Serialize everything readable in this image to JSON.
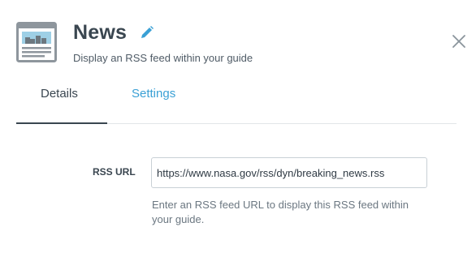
{
  "header": {
    "title": "News",
    "subtitle": "Display an RSS feed within your guide",
    "widget_icon": "news-widget-icon",
    "edit_icon": "pencil-icon",
    "close_icon": "close-icon"
  },
  "tabs": [
    {
      "label": "Details",
      "active": true
    },
    {
      "label": "Settings",
      "active": false
    }
  ],
  "form": {
    "rss_url_label": "RSS URL",
    "rss_url_value": "https://www.nasa.gov/rss/dyn/breaking_news.rss",
    "help_text": "Enter an RSS feed URL to display this RSS feed within your guide."
  },
  "colors": {
    "title": "#3a4650",
    "accent_link": "#3aa0d5",
    "icon_blue": "#9ed0e6",
    "icon_gray": "#8e969d",
    "divider": "#e1e5e8"
  }
}
